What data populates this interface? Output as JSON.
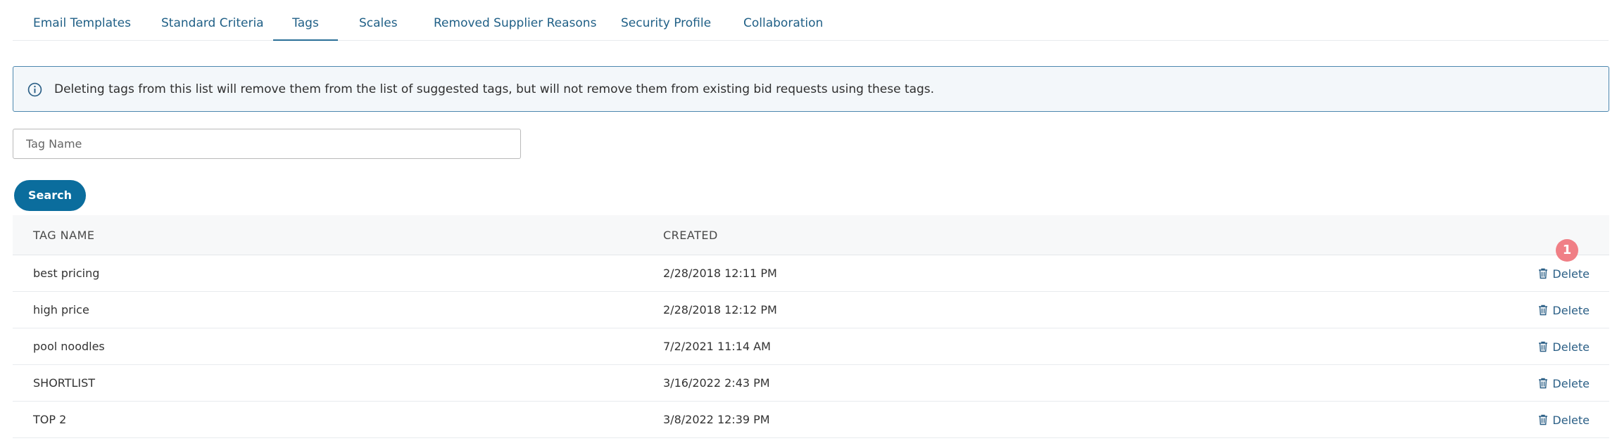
{
  "tabs": [
    {
      "label": "Email Templates"
    },
    {
      "label": "Standard Criteria"
    },
    {
      "label": "Tags"
    },
    {
      "label": "Scales"
    },
    {
      "label": "Removed Supplier Reasons"
    },
    {
      "label": "Security Profile"
    },
    {
      "label": "Collaboration"
    }
  ],
  "active_tab": "Tags",
  "alert": {
    "icon": "info-icon",
    "text": "Deleting tags from this list will remove them from the list of suggested tags, but will not remove them from existing bid requests using these tags."
  },
  "search": {
    "placeholder": "Tag Name",
    "value": "",
    "button_label": "Search"
  },
  "table": {
    "headers": {
      "name": "TAG NAME",
      "created": "CREATED"
    },
    "delete_label": "Delete",
    "rows": [
      {
        "name": "best pricing",
        "created": "2/28/2018 12:11 PM"
      },
      {
        "name": "high price",
        "created": "2/28/2018 12:12 PM"
      },
      {
        "name": "pool noodles",
        "created": "7/2/2021 11:14 AM"
      },
      {
        "name": "SHORTLIST",
        "created": "3/16/2022 2:43 PM"
      },
      {
        "name": "TOP 2",
        "created": "3/8/2022 12:39 PM"
      }
    ]
  },
  "badge": {
    "count": "1"
  },
  "colors": {
    "accent": "#0b6d9d",
    "link": "#1f5f86",
    "alert_border": "#4d87ae",
    "badge": "#f07f86"
  }
}
